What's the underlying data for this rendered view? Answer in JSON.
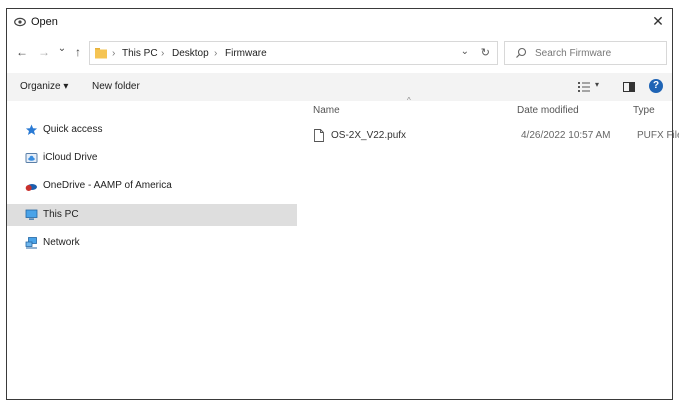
{
  "window": {
    "title": "Open",
    "close": "✕"
  },
  "nav": {
    "back": "←",
    "forward": "→",
    "recent": "⌄",
    "up": "↑"
  },
  "address": {
    "crumbs": [
      "This PC",
      "Desktop",
      "Firmware"
    ],
    "separator": "›",
    "dropdown": "⌄",
    "refresh": "↻"
  },
  "search": {
    "placeholder": "Search Firmware"
  },
  "commandbar": {
    "organize": "Organize ▾",
    "new_folder": "New folder",
    "view_chevron": "▾",
    "help": "?"
  },
  "sidebar": {
    "items": [
      {
        "label": "Quick access",
        "icon": "star-icon"
      },
      {
        "label": "iCloud Drive",
        "icon": "icloud-icon"
      },
      {
        "label": "OneDrive - AAMP of America",
        "icon": "onedrive-icon"
      },
      {
        "label": "This PC",
        "icon": "computer-icon",
        "selected": true
      },
      {
        "label": "Network",
        "icon": "network-icon"
      }
    ]
  },
  "columns": {
    "name": "Name",
    "date": "Date modified",
    "type": "Type",
    "sort_indicator": "^"
  },
  "files": [
    {
      "name": "OS-2X_V22.pufx",
      "date": "4/26/2022 10:57 AM",
      "type": "PUFX File"
    }
  ],
  "colors": {
    "accent": "#1f64b5",
    "folder": "#f5c453",
    "selection": "#dedede"
  }
}
